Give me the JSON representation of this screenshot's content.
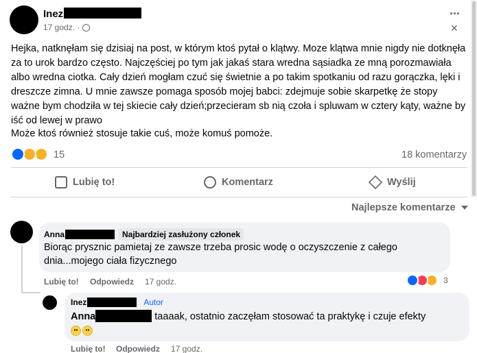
{
  "post": {
    "author_name": "Inez",
    "time": "17 godz. ·",
    "body": "Hejka, natknęłam się dzisiaj na post, w którym ktoś pytał o klątwy. Moze klątwa mnie nigdy nie dotknęła za to urok bardzo często. Najczęściej po tym jak jakaś stara wredna sąsiadka ze mną porozmawiała albo wredna ciotka. Cały dzień mogłam czuć się świetnie a po takim spotkaniu od razu gorączka, lęki i dreszcze zimna. U mnie zawsze pomaga sposób mojej babci: zdejmuje sobie skarpetkę że stopy ważne bym chodziła w tej skiecie cały dzień;przecieram sb nią czoła i spluwam w cztery kąty, ważne by iść od lewej w prawo",
    "body2": "Może ktoś również stosuje takie cuś, może komuś pomoże.",
    "reaction_count": "15",
    "comment_count": "18 komentarzy",
    "more": "···",
    "close": "✕"
  },
  "actions": {
    "like": "Lubię to!",
    "comment": "Komentarz",
    "share": "Wyślij"
  },
  "sort": {
    "label": "Najlepsze komentarze"
  },
  "comments": [
    {
      "author": "Anna",
      "badge": "Najbardziej zasłużony członek",
      "text": "Biorąc prysznic pamietaj ze zawsze trzeba prosic wodę o oczyszczenie z całego dnia...mojego ciała fizycznego",
      "like": "Lubię to!",
      "reply": "Odpowiedz",
      "time": "17 godz.",
      "reaction_count": "3"
    },
    {
      "author": "Inez",
      "badge": "Autor",
      "mention": "Anna",
      "text": "taaaak, ostatnio zaczęłam stosować ta praktykę i czuje efekty",
      "like": "Lubię to!",
      "reply": "Odpowiedz",
      "time": "17 godz."
    }
  ],
  "colors": {
    "like_blue": "#0866ff",
    "love_red": "#f33e58",
    "haha_yellow": "#f7b125",
    "author_badge": "#0866ff"
  }
}
